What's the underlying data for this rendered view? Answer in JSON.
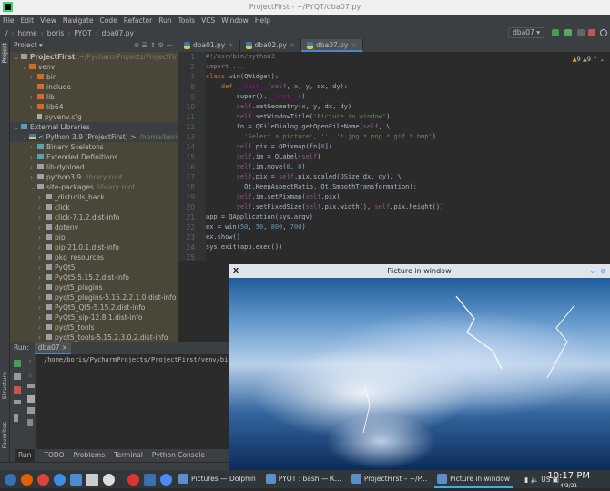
{
  "window_title": "ProjectFirst - ~/PYQT/dba07.py",
  "menu": [
    "File",
    "Edit",
    "View",
    "Navigate",
    "Code",
    "Refactor",
    "Run",
    "Tools",
    "VCS",
    "Window",
    "Help"
  ],
  "breadcrumb": [
    "/",
    "home",
    "boris",
    "PYQT",
    "dba07.py"
  ],
  "run_config": "dba07",
  "project_panel": {
    "title": "Project",
    "stripe_label": "Project"
  },
  "tree": [
    {
      "label": "ProjectFirst",
      "hint": "~/PycharmProjects/ProjectFirst",
      "indent": 0,
      "arrow": "v",
      "icon": "folder",
      "bold": true
    },
    {
      "label": "venv",
      "indent": 1,
      "arrow": "v",
      "icon": "folder-orange"
    },
    {
      "label": "bin",
      "indent": 2,
      "arrow": ">",
      "icon": "folder-orange"
    },
    {
      "label": "include",
      "indent": 2,
      "arrow": "",
      "icon": "folder-orange"
    },
    {
      "label": "lib",
      "indent": 2,
      "arrow": ">",
      "icon": "folder-orange"
    },
    {
      "label": "lib64",
      "indent": 2,
      "arrow": ">",
      "icon": "folder-orange"
    },
    {
      "label": "pyvenv.cfg",
      "indent": 2,
      "arrow": "",
      "icon": "file"
    },
    {
      "label": "External Libraries",
      "indent": 0,
      "arrow": "v",
      "icon": "library"
    },
    {
      "label": "< Python 3.9 (ProjectFirst) >",
      "hint": "/home/boris/Py",
      "indent": 1,
      "arrow": "v",
      "icon": "python"
    },
    {
      "label": "Binary Skeletons",
      "indent": 2,
      "arrow": ">",
      "icon": "library"
    },
    {
      "label": "Extended Definitions",
      "indent": 2,
      "arrow": ">",
      "icon": "library"
    },
    {
      "label": "lib-dynload",
      "indent": 2,
      "arrow": ">",
      "icon": "folder"
    },
    {
      "label": "python3.9",
      "hint": "library root",
      "indent": 2,
      "arrow": ">",
      "icon": "folder"
    },
    {
      "label": "site-packages",
      "hint": "library root",
      "indent": 2,
      "arrow": "v",
      "icon": "folder"
    },
    {
      "label": "_distutils_hack",
      "indent": 3,
      "arrow": ">",
      "icon": "folder"
    },
    {
      "label": "click",
      "indent": 3,
      "arrow": ">",
      "icon": "folder"
    },
    {
      "label": "click-7.1.2.dist-info",
      "indent": 3,
      "arrow": ">",
      "icon": "folder"
    },
    {
      "label": "dotenv",
      "indent": 3,
      "arrow": ">",
      "icon": "folder"
    },
    {
      "label": "pip",
      "indent": 3,
      "arrow": ">",
      "icon": "folder"
    },
    {
      "label": "pip-21.0.1.dist-info",
      "indent": 3,
      "arrow": ">",
      "icon": "folder"
    },
    {
      "label": "pkg_resources",
      "indent": 3,
      "arrow": ">",
      "icon": "folder"
    },
    {
      "label": "PyQt5",
      "indent": 3,
      "arrow": ">",
      "icon": "folder"
    },
    {
      "label": "PyQt5-5.15.2.dist-info",
      "indent": 3,
      "arrow": ">",
      "icon": "folder"
    },
    {
      "label": "pyqt5_plugins",
      "indent": 3,
      "arrow": ">",
      "icon": "folder"
    },
    {
      "label": "pyqt5_plugins-5.15.2.2.1.0.dist-info",
      "indent": 3,
      "arrow": ">",
      "icon": "folder"
    },
    {
      "label": "PyQt5_Qt5-5.15.2.dist-info",
      "indent": 3,
      "arrow": ">",
      "icon": "folder"
    },
    {
      "label": "PyQt5_sip-12.8.1.dist-info",
      "indent": 3,
      "arrow": ">",
      "icon": "folder"
    },
    {
      "label": "pyqt5_tools",
      "indent": 3,
      "arrow": ">",
      "icon": "folder"
    },
    {
      "label": "pyqt5_tools-5.15.2.3.0.2.dist-info",
      "indent": 3,
      "arrow": ">",
      "icon": "folder"
    }
  ],
  "editor_tabs": [
    "dba01.py",
    "dba02.py",
    "dba07.py"
  ],
  "active_tab": 2,
  "inspections": {
    "warnings": "9",
    "weak_warnings": "9"
  },
  "code": [
    {
      "n": "1",
      "html": "<span class='cm'>#!/usr/bin/python3</span>"
    },
    {
      "n": "2",
      "html": "<span class='cm'>import ...</span>"
    },
    {
      "n": "7",
      "html": "<span class='kw'>class</span> win(QWidget):"
    },
    {
      "n": "8",
      "html": "    <span class='kw'>def</span> <span class='fn'>__init__</span>(<span class='self'>self</span>, x, y, dx, dy):"
    },
    {
      "n": "9",
      "html": "        super().<span class='fn'>__init__</span>()"
    },
    {
      "n": "10",
      "html": "        <span class='self'>self</span>.setGeometry(x, y, dx, dy)"
    },
    {
      "n": "11",
      "html": "        <span class='self'>self</span>.setWindowTitle(<span class='str'>'Picture in window'</span>)"
    },
    {
      "n": "12",
      "html": "        fn = QFileDialog.getOpenFileName(<span class='self'>self</span>, \\"
    },
    {
      "n": "13",
      "html": "          <span class='str'>'Select a picture'</span>, <span class='str'>''</span>, <span class='str'>'*.jpg *.png *.gif *.bmp'</span>)"
    },
    {
      "n": "14",
      "html": "        <span class='self'>self</span>.pix = QPixmap(fn[<span class='num'>0</span>])"
    },
    {
      "n": "15",
      "html": "        <span class='self'>self</span>.im = QLabel(<span class='self'>self</span>)"
    },
    {
      "n": "16",
      "html": "        <span class='self'>self</span>.im.move(<span class='num'>0</span>, <span class='num'>0</span>)"
    },
    {
      "n": "17",
      "html": "        <span class='self'>self</span>.pix = <span class='self'>self</span>.pix.scaled(QSize(dx, dy), \\"
    },
    {
      "n": "18",
      "html": "          Qt.KeepAspectRatio, Qt.SmoothTransformation);"
    },
    {
      "n": "19",
      "html": "        <span class='self'>self</span>.im.setPixmap(<span class='self'>self</span>.pix)"
    },
    {
      "n": "20",
      "html": "        <span class='self'>self</span>.setFixedSize(<span class='self'>self</span>.pix.width(), <span class='self'>self</span>.pix.height())"
    },
    {
      "n": "21",
      "html": "app = QApplication(sys.argv)"
    },
    {
      "n": "22",
      "html": "ex = win(<span class='num'>50</span>, <span class='num'>50</span>, <span class='num'>800</span>, <span class='num'>700</span>)"
    },
    {
      "n": "23",
      "html": "ex.show()"
    },
    {
      "n": "24",
      "html": "sys.exit(app.exec())"
    },
    {
      "n": "25",
      "html": ""
    }
  ],
  "run": {
    "label": "Run:",
    "tab": "dba07",
    "output": "/home/boris/PycharmProjects/ProjectFirst/venv/bin"
  },
  "side_labels": [
    "Structure",
    "Favorites"
  ],
  "bottom_tabs": [
    "Run",
    "TODO",
    "Problems",
    "Terminal",
    "Python Console"
  ],
  "taskbar": {
    "tasks": [
      "Pictures — Dolphin",
      "PYQT : bash — K...",
      "ProjectFirst – ~/P...",
      "Picture in window"
    ],
    "active_task": 3,
    "keyboard": "US",
    "time": "10:17 PM",
    "date": "4/3/21"
  },
  "picture_window": {
    "title": "Picture in window"
  }
}
